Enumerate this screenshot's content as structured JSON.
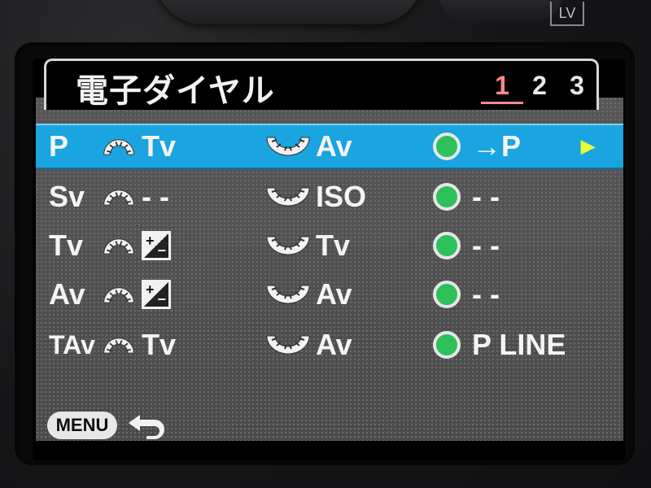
{
  "camera": {
    "lv_label": "LV"
  },
  "header": {
    "title": "電子ダイヤル",
    "tabs": [
      {
        "label": "1",
        "active": true
      },
      {
        "label": "2",
        "active": false
      },
      {
        "label": "3",
        "active": false
      }
    ]
  },
  "rows": [
    {
      "mode": "P",
      "front": "Tv",
      "front_icon": "",
      "rear": "Av",
      "button": "→P",
      "selected": true,
      "submenu_icon": "▶"
    },
    {
      "mode": "Sv",
      "front": "- -",
      "front_icon": "",
      "rear": "ISO",
      "button": "- -",
      "selected": false
    },
    {
      "mode": "Tv",
      "front": "",
      "front_icon": "exposure-compensation-icon",
      "rear": "Tv",
      "button": "- -",
      "selected": false
    },
    {
      "mode": "Av",
      "front": "",
      "front_icon": "exposure-compensation-icon",
      "rear": "Av",
      "button": "- -",
      "selected": false
    },
    {
      "mode": "TAv",
      "front": "Tv",
      "front_icon": "",
      "rear": "Av",
      "button": "P LINE",
      "selected": false
    }
  ],
  "footer": {
    "menu_label": "MENU",
    "back_icon": "return-arrow-icon"
  },
  "colors": {
    "selected_row": "#1aa4e0",
    "active_tab": "#ff8a8a",
    "green_button": "#2ec05a"
  }
}
